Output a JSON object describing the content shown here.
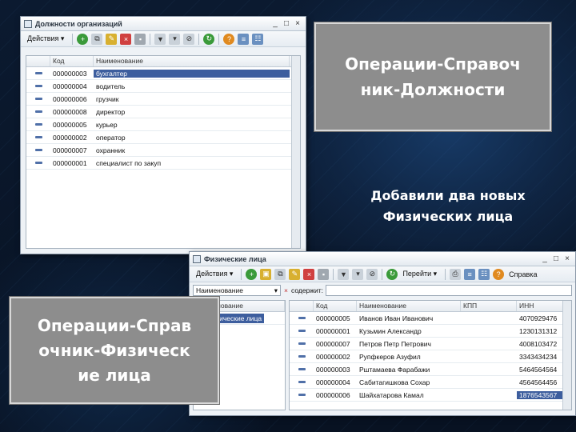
{
  "win1": {
    "title": "Должности организаций",
    "actions": "Действия ▾",
    "columns": [
      "Код",
      "Наименование"
    ],
    "rows": [
      {
        "code": "000000003",
        "name": "бухгалтер"
      },
      {
        "code": "000000004",
        "name": "водитель"
      },
      {
        "code": "000000006",
        "name": "грузчик"
      },
      {
        "code": "000000008",
        "name": "директор"
      },
      {
        "code": "000000005",
        "name": "курьер"
      },
      {
        "code": "000000002",
        "name": "оператор"
      },
      {
        "code": "000000007",
        "name": "охранник"
      },
      {
        "code": "000000001",
        "name": "специалист по закуп"
      }
    ]
  },
  "win2": {
    "title": "Физические лица",
    "actions": "Действия ▾",
    "go_down": "Перейти ▾",
    "help": "Справка",
    "filter_field": "Наименование",
    "contains_label": "содержит:",
    "tree_header": "Наименование",
    "tree_item": "Физические лица",
    "columns": [
      "Код",
      "Наименование",
      "ИНН",
      "КПП"
    ],
    "rows": [
      {
        "code": "000000005",
        "name": "Иванов Иван Иванович",
        "inn": "4070929476"
      },
      {
        "code": "000000001",
        "name": "Кузьмин Александр",
        "inn": "1230131312"
      },
      {
        "code": "000000007",
        "name": "Петров Петр Петрович",
        "inn": "4008103472"
      },
      {
        "code": "000000002",
        "name": "Рупфкеров Азуфил",
        "inn": "3343434234"
      },
      {
        "code": "000000003",
        "name": "Рштамаева Фарабажи",
        "inn": "5464564564"
      },
      {
        "code": "000000004",
        "name": "Сабитагишкова Сохар",
        "inn": "4564564456"
      },
      {
        "code": "000000006",
        "name": "Шайхатарова Камал",
        "inn": "1876543567"
      }
    ]
  },
  "callout_positions": "Операции-Справочник-Должности",
  "callout_persons": "Операции-Справочник-Физические лица",
  "callout_positions_lines": [
    "Операции-Справоч",
    "ник-Должности"
  ],
  "callout_persons_lines": [
    "Операции-Справ",
    "очник-Физическ",
    "ие лица"
  ],
  "note_lines": [
    "Добавили два новых",
    "Физических лица"
  ]
}
